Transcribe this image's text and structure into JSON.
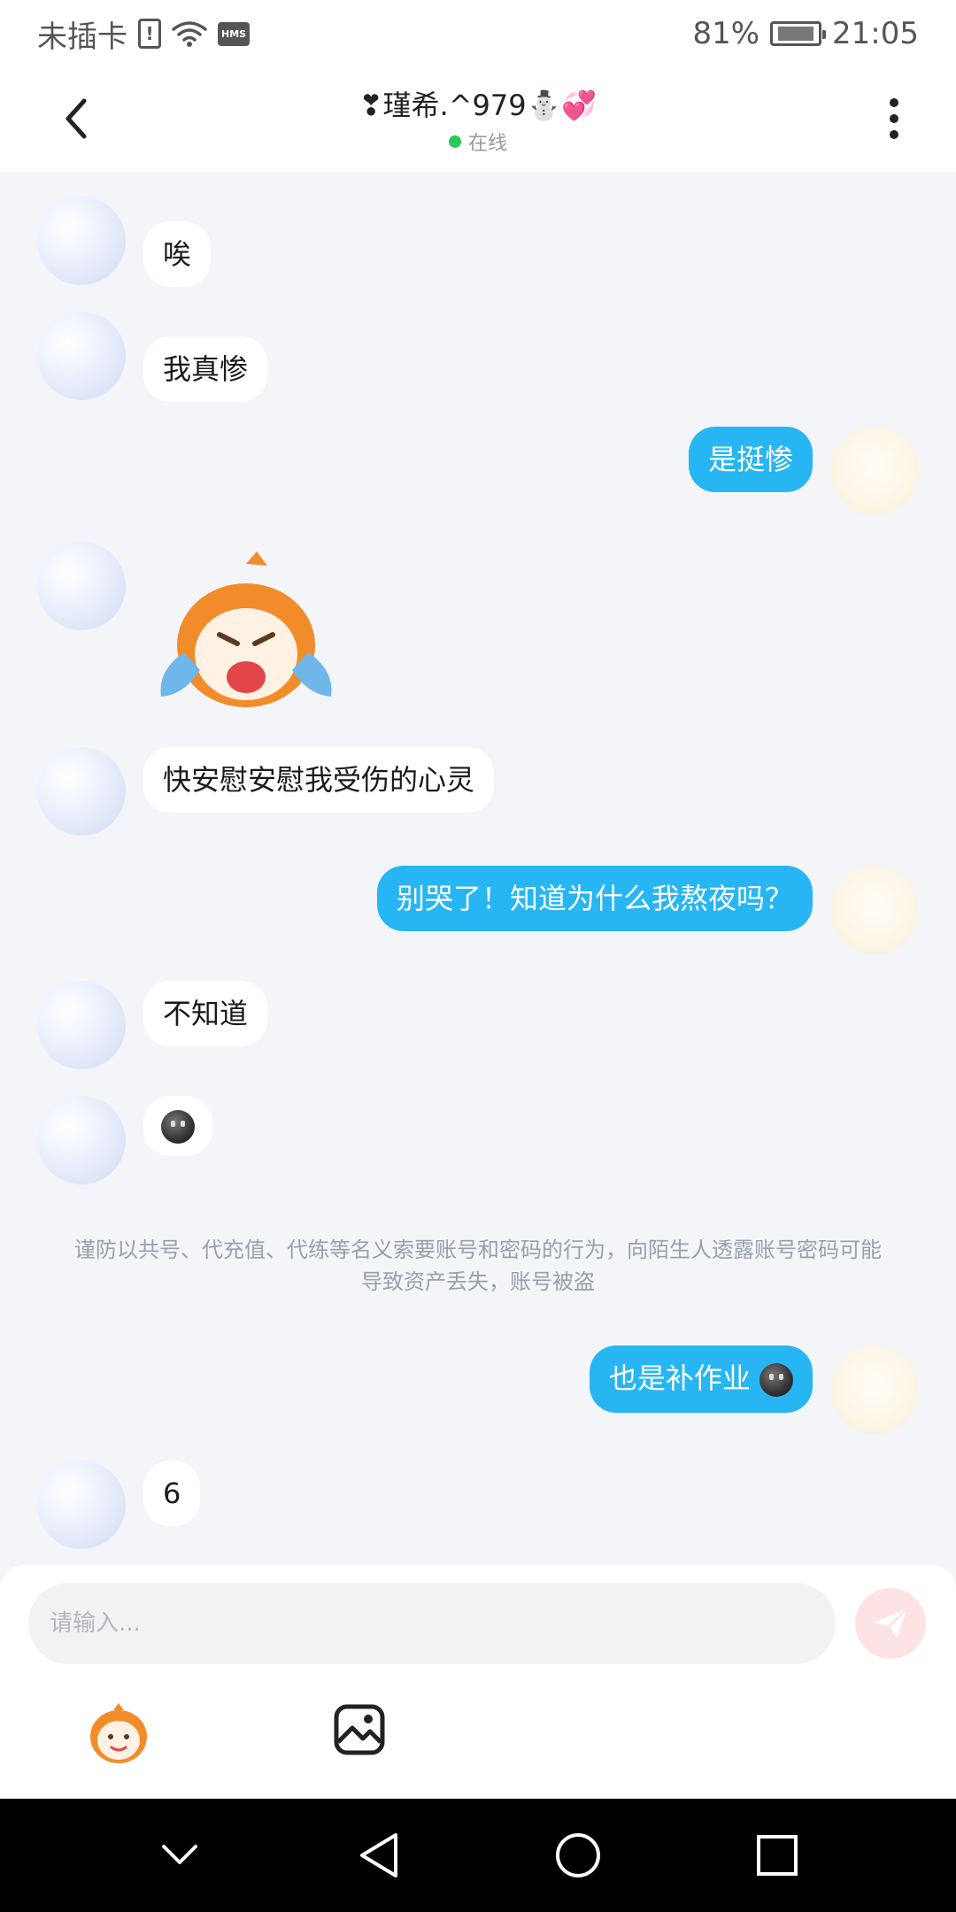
{
  "status_bar": {
    "carrier": "未插卡",
    "hms": "HMS",
    "battery": "81%",
    "time": "21:05"
  },
  "header": {
    "title": "❣瑾希.^979⛄💞",
    "online": "在线"
  },
  "messages": [
    {
      "side": "peer",
      "text": "唉"
    },
    {
      "side": "peer",
      "text": "我真惨"
    },
    {
      "side": "self",
      "text": "是挺惨"
    },
    {
      "side": "peer",
      "type": "sticker",
      "sticker": "crying-mascot"
    },
    {
      "side": "peer",
      "text": "快安慰安慰我受伤的心灵"
    },
    {
      "side": "self",
      "text": "别哭了！知道为什么我熬夜吗？"
    },
    {
      "side": "peer",
      "text": "不知道"
    },
    {
      "side": "peer",
      "type": "emoji",
      "emoji": "dark-smiley"
    },
    {
      "side": "self",
      "text": "也是补作业",
      "emoji": "dark-smiley"
    },
    {
      "side": "peer",
      "text": "6"
    }
  ],
  "notice": "谨防以共号、代充值、代练等名义索要账号和密码的行为，向陌生人透露账号密码可能导致资产丢失，账号被盗",
  "input": {
    "placeholder": "请输入..."
  },
  "icons": {
    "back": "chevron-left-icon",
    "more": "more-vertical-icon",
    "send": "send-icon",
    "sticker": "sticker-icon",
    "image": "image-icon"
  },
  "colors": {
    "self_bubble": "#27b6f3",
    "peer_bubble": "#ffffff",
    "background": "#f3f5f9",
    "online": "#2ec55a",
    "send_disabled": "#fde3e3"
  }
}
